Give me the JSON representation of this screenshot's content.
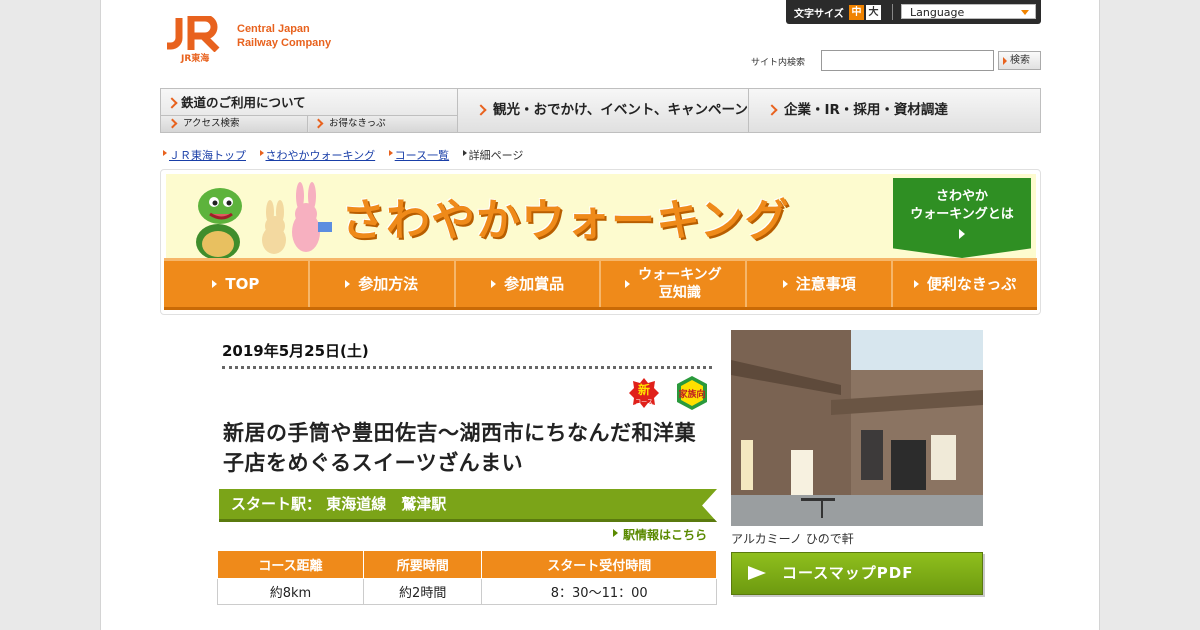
{
  "header": {
    "logo_company_line1": "Central Japan",
    "logo_company_line2": "Railway Company",
    "logo_sub": "JR東海",
    "font_size_label": "文字サイズ",
    "font_size_medium": "中",
    "font_size_large": "大",
    "language_label": "Language",
    "search_label": "サイト内検索",
    "search_value": "",
    "search_button": "検索"
  },
  "global_nav": {
    "railway": "鉄道のご利用について",
    "access": "アクセス検索",
    "tickets": "お得なきっぷ",
    "tourism": "観光・おでかけ、イベント、キャンペーン",
    "corporate": "企業・IR・採用・資材調達"
  },
  "breadcrumb": {
    "top": "ＪＲ東海トップ",
    "walking": "さわやかウォーキング",
    "courses": "コース一覧",
    "current": "詳細ページ"
  },
  "banner": {
    "title": "さわやかウォーキング",
    "whatis_line1": "さわやか",
    "whatis_line2": "ウォーキングとは",
    "nav": {
      "top": "TOP",
      "how": "参加方法",
      "prizes": "参加賞品",
      "knowledge_line1": "ウォーキング",
      "knowledge_line2": "豆知識",
      "notes": "注意事項",
      "tickets": "便利なきっぷ"
    }
  },
  "course": {
    "date": "2019年5月25日(土)",
    "badge_new": "新",
    "badge_new_sub": "コース",
    "badge_family": "家族向",
    "title": "新居の手筒や豊田佐吉～湖西市にちなんだ和洋菓子店をめぐるスイーツざんまい",
    "start_station": "スタート駅：  東海道線　鷲津駅",
    "station_link": "駅情報はこちら",
    "table": {
      "headers": [
        "コース距離",
        "所要時間",
        "スタート受付時間"
      ],
      "values": [
        "約8km",
        "約2時間",
        "8：30～11：00"
      ]
    },
    "photo_caption": "アルカミーノ ひので軒",
    "pdf_button": "コースマップPDF"
  },
  "colors": {
    "brand_orange": "#ef8a1a",
    "jr_orange": "#e8621e",
    "green": "#7ba418"
  }
}
